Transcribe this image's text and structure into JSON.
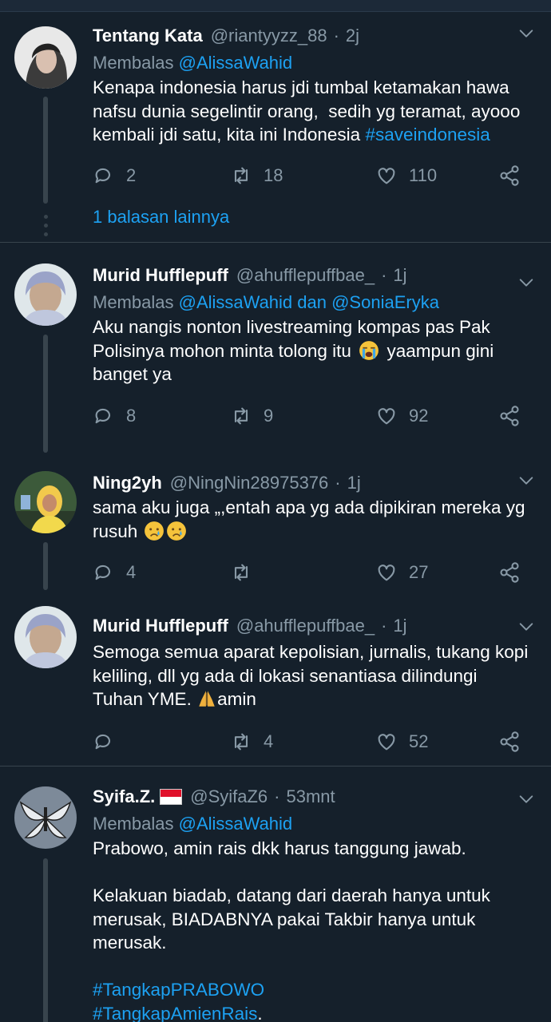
{
  "tweets": [
    {
      "name": "Tentang Kata",
      "handle": "@riantyyzz_88",
      "time": "2j",
      "reply_prefix": "Membalas",
      "reply_to": "@AlissaWahid",
      "text": "Kenapa indonesia harus jdi tumbal ketamakan hawa nafsu dunia segelintir orang,  sedih yg teramat, ayooo kembali jdi satu, kita ini Indonesia ",
      "hashtag": "#saveindonesia",
      "replies": "2",
      "retweets": "18",
      "likes": "110",
      "more_replies": "1 balasan lainnya"
    },
    {
      "name": "Murid Hufflepuff",
      "handle": "@ahufflepuffbae_",
      "time": "1j",
      "reply_prefix": "Membalas",
      "reply_to": "@AlissaWahid dan @SoniaEryka",
      "text_a": "Aku nangis nonton livestreaming kompas pas Pak Polisinya mohon minta tolong itu",
      "text_b": " yaampun gini banget ya",
      "replies": "8",
      "retweets": "9",
      "likes": "92"
    },
    {
      "name": "Ning2yh",
      "handle": "@NingNin28975376",
      "time": "1j",
      "text": "sama aku juga „,entah apa yg ada dipikiran mereka yg rusuh",
      "replies": "4",
      "retweets": "",
      "likes": "27"
    },
    {
      "name": "Murid Hufflepuff",
      "handle": "@ahufflepuffbae_",
      "time": "1j",
      "text_a": "Semoga semua aparat kepolisian, jurnalis, tukang kopi keliling, dll yg ada di lokasi senantiasa dilindungi Tuhan YME.",
      "text_b": "amin",
      "replies": "",
      "retweets": "4",
      "likes": "52"
    },
    {
      "name": "Syifa.Z.",
      "handle": "@SyifaZ6",
      "time": "53mnt",
      "reply_prefix": "Membalas",
      "reply_to": "@AlissaWahid",
      "text": "Prabowo, amin rais dkk harus tanggung jawab.\n\nKelakuan biadab, datang dari daerah hanya untuk merusak, BIADABNYA pakai Takbir hanya untuk merusak.\n",
      "hashtag1": "#TangkapPRABOWO",
      "hashtag2": "#TangkapAmienRais",
      "hashtag2_suffix": "."
    }
  ],
  "separator": "·",
  "colors": {
    "background": "#15202b",
    "link": "#1da1f2",
    "muted": "#8899a6",
    "divider": "#38444d"
  },
  "icons": [
    "reply-icon",
    "retweet-icon",
    "like-icon",
    "share-icon",
    "chevron-down-icon",
    "loudly-crying-face-emoji",
    "crying-face-emoji",
    "folded-hands-emoji",
    "indonesia-flag"
  ]
}
